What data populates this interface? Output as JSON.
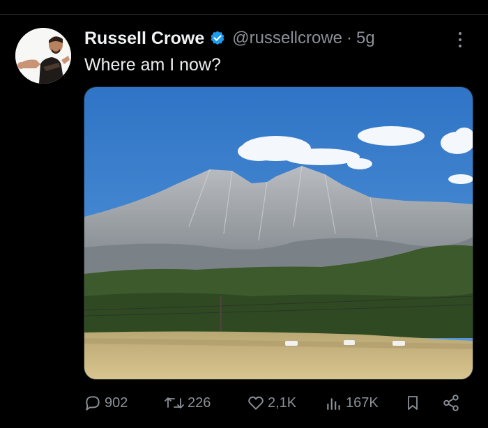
{
  "tweet": {
    "author_name": "Russell Crowe",
    "verified": true,
    "handle": "@russellcrowe",
    "separator": "·",
    "time": "5g",
    "text": "Where am I now?",
    "accent_color": "#1d9bf0"
  },
  "media": {
    "icon": "photo-mountain-landscape"
  },
  "actions": {
    "replies": {
      "icon": "reply-icon",
      "count": "902"
    },
    "reposts": {
      "icon": "retweet-icon",
      "count": "226"
    },
    "likes": {
      "icon": "heart-icon",
      "count": "2,1K"
    },
    "views": {
      "icon": "views-icon",
      "count": "167K"
    },
    "bookmark": {
      "icon": "bookmark-icon"
    },
    "share": {
      "icon": "share-icon"
    }
  }
}
